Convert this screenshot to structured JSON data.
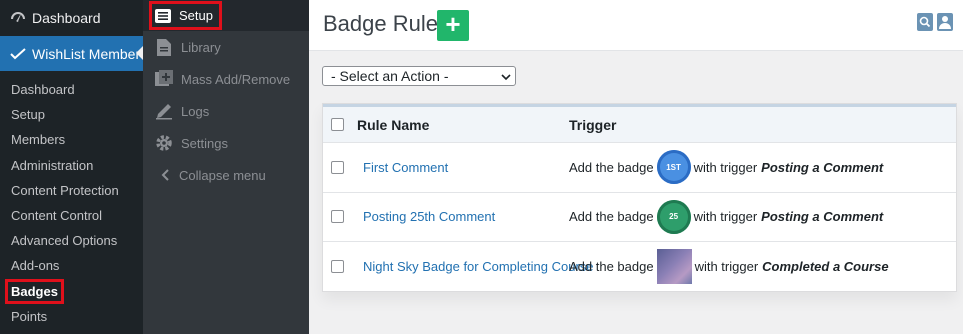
{
  "wp_sidebar": {
    "top_items": [
      {
        "label": "Dashboard",
        "icon": "dashboard-icon"
      },
      {
        "label": "WishList Member",
        "icon": "wishlist-check-icon"
      }
    ],
    "sub_items": [
      {
        "label": "Dashboard"
      },
      {
        "label": "Setup"
      },
      {
        "label": "Members"
      },
      {
        "label": "Administration"
      },
      {
        "label": "Content Protection"
      },
      {
        "label": "Content Control"
      },
      {
        "label": "Advanced Options"
      },
      {
        "label": "Add-ons"
      },
      {
        "label": "Badges"
      },
      {
        "label": "Points"
      }
    ]
  },
  "wl_menu": {
    "setup_label": "Setup",
    "items": [
      {
        "label": "Library",
        "icon": "document-icon"
      },
      {
        "label": "Mass Add/Remove",
        "icon": "plus-box-icon"
      },
      {
        "label": "Logs",
        "icon": "pencil-icon"
      },
      {
        "label": "Settings",
        "icon": "gear-icon"
      },
      {
        "label": "Collapse menu",
        "icon": "chevron-left-icon"
      }
    ]
  },
  "main": {
    "title": "Badge Rules",
    "add_button": "+",
    "action_select": "- Select an Action -",
    "table": {
      "headers": {
        "name": "Rule Name",
        "trigger": "Trigger"
      },
      "rows": [
        {
          "name": "First Comment",
          "prefix": "Add the badge",
          "badge_text": "1ST",
          "badge_color": "#4a90e2",
          "with": "with trigger",
          "trigger": "Posting a Comment"
        },
        {
          "name": "Posting 25th Comment",
          "prefix": "Add the badge",
          "badge_text": "25",
          "badge_color": "#2e9e6b",
          "with": "with trigger",
          "trigger": "Posting a Comment"
        },
        {
          "name": "Night Sky Badge for Completing Course",
          "prefix": "Add the badge",
          "badge_text": "",
          "badge_color": "",
          "with": "with trigger",
          "trigger": "Completed a Course"
        }
      ]
    }
  },
  "colors": {
    "accent_green": "#21b66b",
    "wp_blue": "#2271b1",
    "highlight_red": "#e0101b"
  }
}
